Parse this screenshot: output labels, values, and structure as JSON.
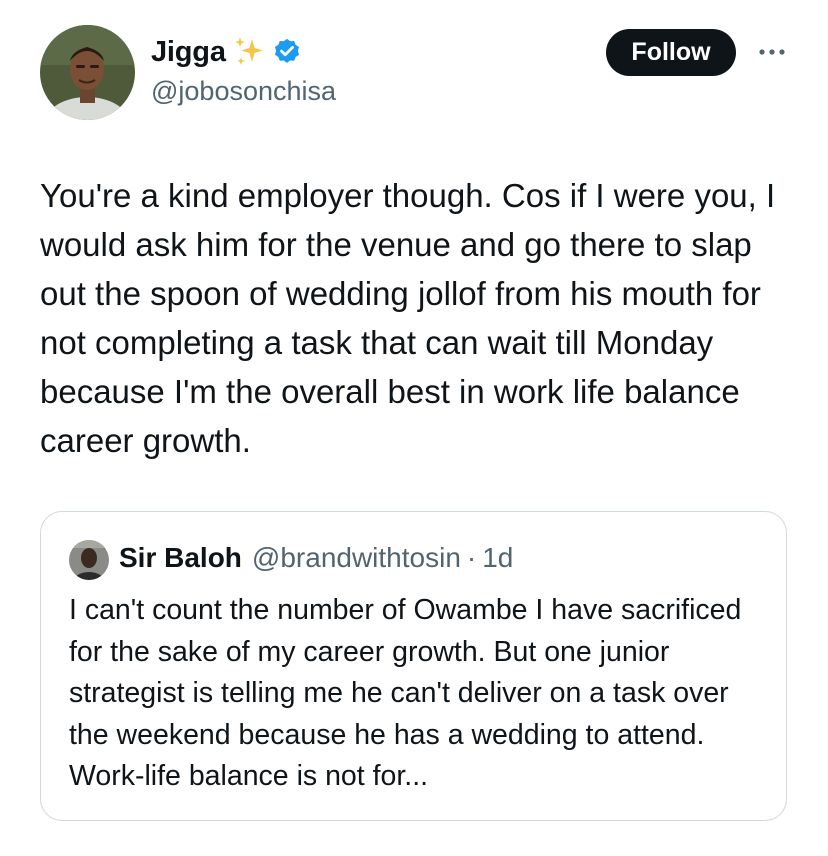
{
  "author": {
    "display_name": "Jigga",
    "handle": "@jobosonchisa",
    "name_emoji": "sparkles-icon",
    "verified": true,
    "avatar": "profile-photo"
  },
  "follow_button": {
    "label": "Follow"
  },
  "more_menu": {
    "icon": "more-horizontal-icon"
  },
  "tweet": {
    "text": "You're a kind employer though. Cos if I were you, I would ask him for the venue and go there to slap out the spoon of wedding jollof from his mouth for not completing a task that can wait till Monday because I'm the overall best in work life balance career growth."
  },
  "quoted_tweet": {
    "display_name": "Sir Baloh",
    "handle": "@brandwithtosin",
    "separator": "·",
    "time": "1d",
    "text": "I can't count the number of Owambe I have sacrificed for the sake of my career growth. But one junior strategist is telling me he can't deliver on a task over the weekend because he has a wedding to attend. Work-life balance is not for..."
  },
  "colors": {
    "text": "#0f1419",
    "muted": "#536471",
    "border": "#cfd9de",
    "verified": "#1d9bf0",
    "sparkle": "#f4c646",
    "follow_bg": "#0f1419",
    "follow_text": "#ffffff"
  }
}
